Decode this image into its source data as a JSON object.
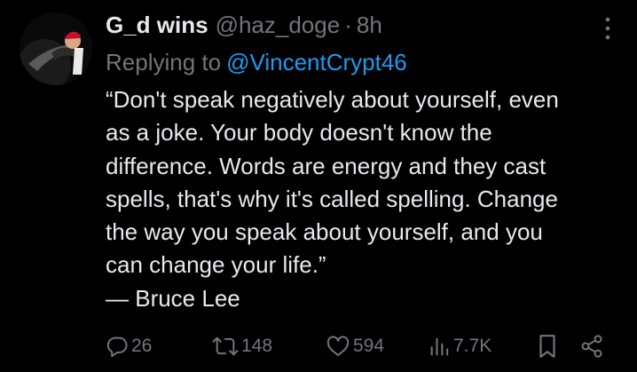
{
  "tweet": {
    "display_name": "G_d wins",
    "handle": "@haz_doge",
    "separator": "·",
    "time": "8h",
    "reply_prefix": "Replying to",
    "reply_handle": "@VincentCrypt46",
    "body_lines": [
      "“Don't speak negatively about yourself, even",
      "as a joke. Your body doesn't know the",
      "difference. Words are energy and they cast",
      "spells, that's why it's called spelling. Change",
      "the way you speak about yourself, and you",
      "can change your life.”",
      "— Bruce Lee"
    ]
  },
  "actions": {
    "replies": "26",
    "reposts": "148",
    "likes": "594",
    "views": "7.7K"
  },
  "icons": {
    "more": "more-vertical-icon",
    "reply": "reply-icon",
    "repost": "repost-icon",
    "like": "heart-icon",
    "views": "views-bar-chart-icon",
    "bookmark": "bookmark-icon",
    "share": "share-icon"
  },
  "colors": {
    "background": "#000000",
    "text": "#e7e9ea",
    "muted": "#71767b",
    "link": "#1d9bf0"
  }
}
